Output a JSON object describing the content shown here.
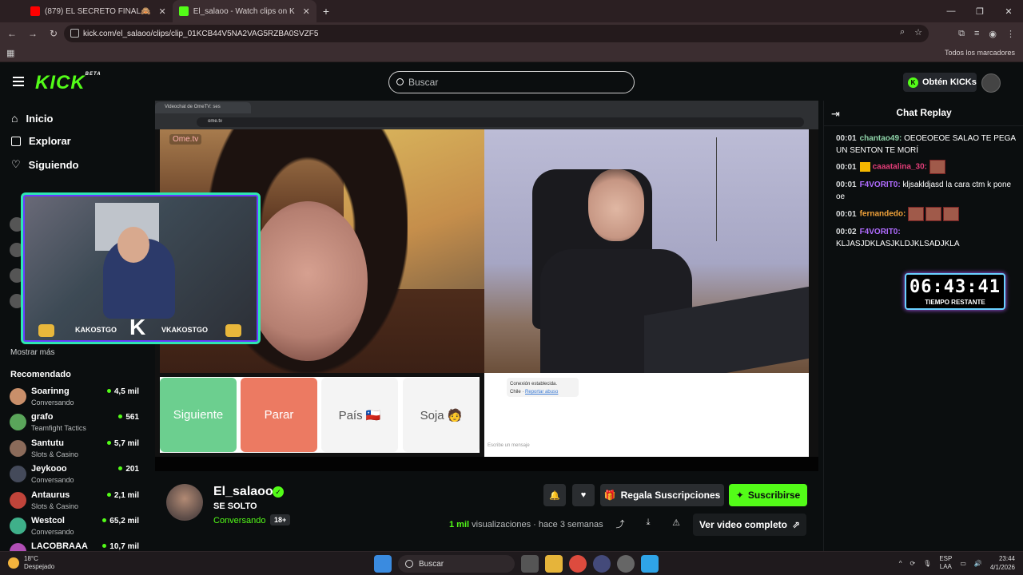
{
  "browser": {
    "tabs": [
      {
        "title": "(879) EL SECRETO FINAL🙈",
        "color": "#ff0000"
      },
      {
        "title": "El_salaoo - Watch clips on K",
        "color": "#53fc18"
      }
    ],
    "new_tab": "+",
    "url": "kick.com/el_salaoo/clips/clip_01KCB44V5NA2VAG5RZBA0SVZF5",
    "bookmarks_label": "Todos los marcadores"
  },
  "header": {
    "logo": "KICK",
    "logo_badge": "BETA",
    "search_placeholder": "Buscar",
    "kicks_button": "Obtén KICKs"
  },
  "sidebar": {
    "nav": [
      {
        "label": "Inicio",
        "icon": "home-icon"
      },
      {
        "label": "Explorar",
        "icon": "explore-icon"
      },
      {
        "label": "Siguiendo",
        "icon": "heart-icon"
      }
    ],
    "show_more": "Mostrar más",
    "recommended_title": "Recomendado",
    "recommended": [
      {
        "name": "Soarinng",
        "category": "Conversando",
        "viewers": "4,5 mil",
        "color": "#c98f6a"
      },
      {
        "name": "grafo",
        "category": "Teamfight Tactics",
        "viewers": "561",
        "color": "#5aa55a"
      },
      {
        "name": "Santutu",
        "category": "Slots & Casino",
        "viewers": "5,7 mil",
        "color": "#8b6b5a"
      },
      {
        "name": "Jeykooo",
        "category": "Conversando",
        "viewers": "201",
        "color": "#444a5a"
      },
      {
        "name": "Antaurus",
        "category": "Slots & Casino",
        "viewers": "2,1 mil",
        "color": "#c0443a"
      },
      {
        "name": "Westcol",
        "category": "Conversando",
        "viewers": "65,2 mil",
        "color": "#3fb08a"
      },
      {
        "name": "LACOBRAAA",
        "category": "",
        "viewers": "10,7 mil",
        "color": "#b04fb5"
      }
    ]
  },
  "video": {
    "inner_tab": "Videochat de OmeTV: ses",
    "inner_url": "ome.tv",
    "ome_logo": "Ome.tv",
    "buttons": [
      {
        "label": "Siguiente",
        "bg": "#6ccf8f"
      },
      {
        "label": "Parar",
        "bg": "#ec7a62"
      },
      {
        "label": "País 🇨🇱",
        "bg": "#f4f4f4"
      },
      {
        "label": "Soja 🧑",
        "bg": "#f4f4f4"
      }
    ],
    "connection_text": "Conexión establecida.",
    "connection_country": "Chile",
    "report": "Reportar abuso",
    "message_placeholder": "Escribe un mensaje",
    "cam_handle_left": "KAKOSTGO",
    "cam_handle_right": "VKAKOSTGO"
  },
  "channel": {
    "name": "El_salaoo",
    "title": "SE SOLTO",
    "category": "Conversando",
    "age": "18+",
    "gift_button": "Regala Suscripciones",
    "subscribe_button": "Suscribirse",
    "views": "1 mil",
    "views_label": "visualizaciones",
    "time_ago": "hace 3 semanas",
    "full_video": "Ver video completo"
  },
  "chat": {
    "title": "Chat Replay",
    "messages": [
      {
        "time": "00:01",
        "user": "chantao49:",
        "user_color": "#8ed3a8",
        "text": "OEOEOEOE SALAO TE PEGA UN SENTON TE MORÍ"
      },
      {
        "time": "00:01",
        "user": "caaatalina_30:",
        "user_color": "#e23d78",
        "text": ""
      },
      {
        "time": "00:01",
        "user": "F4VORIT0:",
        "user_color": "#b06cff",
        "text": "kljsakldjasd la cara ctm k pone oe"
      },
      {
        "time": "00:01",
        "user": "fernandedo:",
        "user_color": "#f0a23a",
        "text": ""
      },
      {
        "time": "00:02",
        "user": "F4VORIT0:",
        "user_color": "#b06cff",
        "text": "KLJASJDKLASJKLDJKLSADJKLA"
      }
    ],
    "timer": "06:43:41",
    "timer_label": "TIEMPO RESTANTE"
  },
  "taskbar": {
    "temp": "18°C",
    "weather": "Despejado",
    "search": "Buscar",
    "lang1": "ESP",
    "lang2": "LAA",
    "time": "23:44",
    "date": "4/1/2026"
  }
}
